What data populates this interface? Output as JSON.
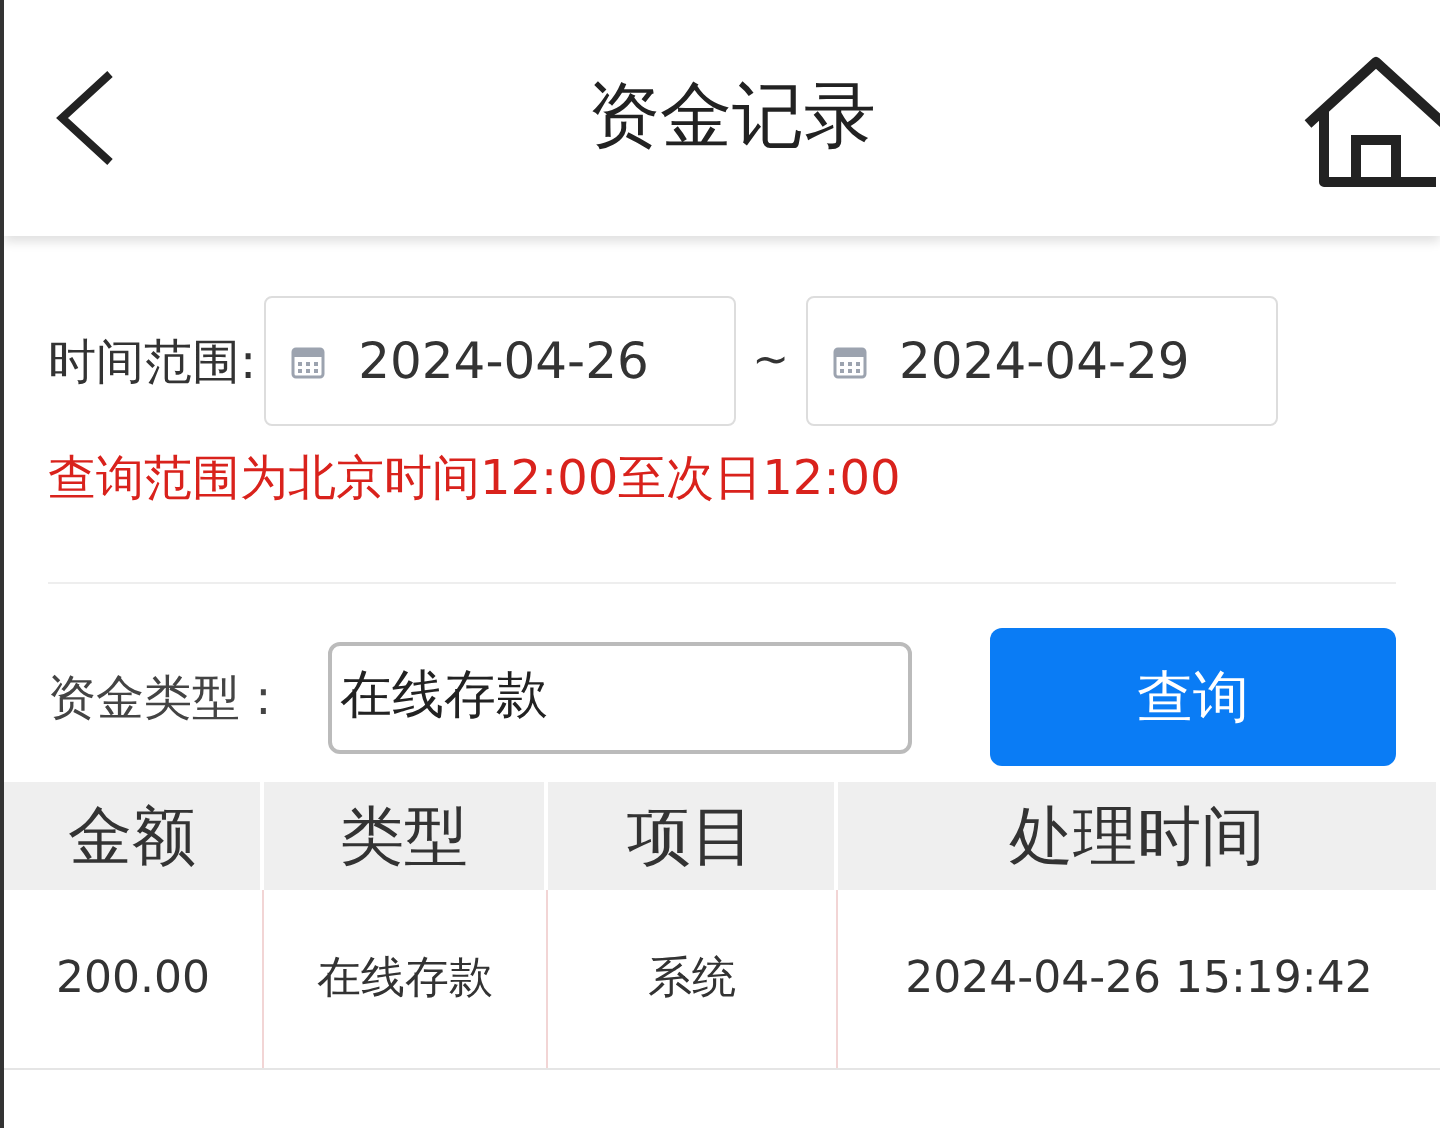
{
  "header": {
    "title": "资金记录"
  },
  "filters": {
    "time_label": "时间范围:",
    "start_date": "2024-04-26",
    "separator": "~",
    "end_date": "2024-04-29",
    "note": "查询范围为北京时间12:00至次日12:00",
    "type_label": "资金类型 :",
    "type_value": "在线存款",
    "query_button": "查询"
  },
  "table": {
    "columns": [
      "金额",
      "类型",
      "项目",
      "处理时间"
    ],
    "rows": [
      [
        "200.00",
        "在线存款",
        "系统",
        "2024-04-26 15:19:42"
      ]
    ]
  }
}
